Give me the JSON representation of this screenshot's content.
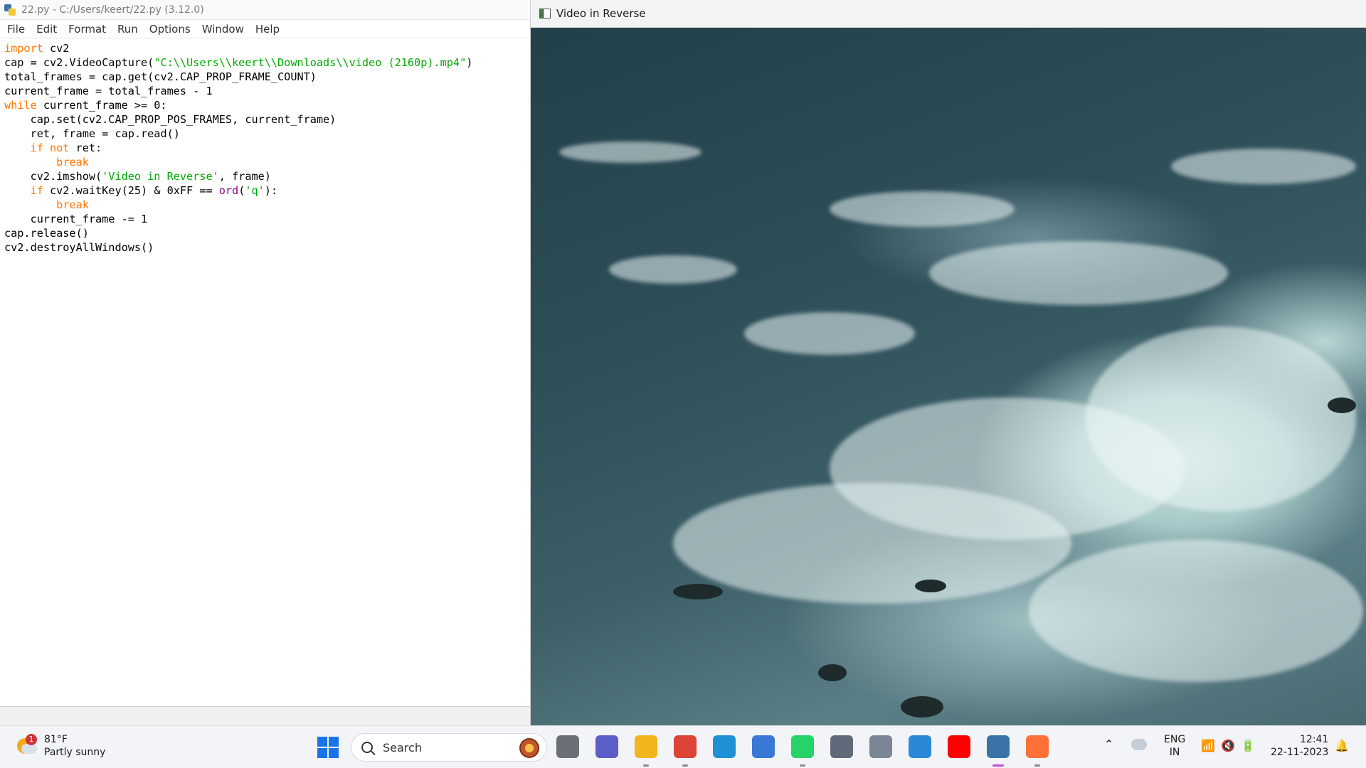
{
  "idle": {
    "title": "22.py - C:/Users/keert/22.py (3.12.0)",
    "menu": [
      "File",
      "Edit",
      "Format",
      "Run",
      "Options",
      "Window",
      "Help"
    ],
    "code_lines": [
      [
        {
          "t": "import",
          "c": "kw"
        },
        {
          "t": " cv2"
        }
      ],
      [
        {
          "t": "cap = cv2.VideoCapture("
        },
        {
          "t": "\"C:\\\\Users\\\\keert\\\\Downloads\\\\video (2160p).mp4\"",
          "c": "str"
        },
        {
          "t": ")"
        }
      ],
      [
        {
          "t": "total_frames = cap.get(cv2.CAP_PROP_FRAME_COUNT)"
        }
      ],
      [
        {
          "t": "current_frame = total_frames - 1"
        }
      ],
      [
        {
          "t": "while",
          "c": "kw"
        },
        {
          "t": " current_frame >= 0:"
        }
      ],
      [
        {
          "t": "    cap.set(cv2.CAP_PROP_POS_FRAMES, current_frame)"
        }
      ],
      [
        {
          "t": "    ret, frame = cap.read()"
        }
      ],
      [
        {
          "t": "    "
        },
        {
          "t": "if not",
          "c": "kw"
        },
        {
          "t": " ret:"
        }
      ],
      [
        {
          "t": "        "
        },
        {
          "t": "break",
          "c": "kw"
        }
      ],
      [
        {
          "t": "    cv2.imshow("
        },
        {
          "t": "'Video in Reverse'",
          "c": "str"
        },
        {
          "t": ", frame)"
        }
      ],
      [
        {
          "t": "    "
        },
        {
          "t": "if",
          "c": "kw"
        },
        {
          "t": " cv2.waitKey(25) & 0xFF == "
        },
        {
          "t": "ord",
          "c": "bi"
        },
        {
          "t": "("
        },
        {
          "t": "'q'",
          "c": "str"
        },
        {
          "t": "):"
        }
      ],
      [
        {
          "t": "        "
        },
        {
          "t": "break",
          "c": "kw"
        }
      ],
      [
        {
          "t": "    current_frame -= 1"
        }
      ],
      [
        {
          "t": "cap.release()"
        }
      ],
      [
        {
          "t": "cv2.destroyAllWindows()"
        }
      ]
    ]
  },
  "video": {
    "title": "Video in Reverse"
  },
  "taskbar": {
    "weather_temp": "81°F",
    "weather_desc": "Partly sunny",
    "weather_badge": "1",
    "search_label": "Search",
    "lang_top": "ENG",
    "lang_bottom": "IN",
    "time": "12:41",
    "date": "22-11-2023",
    "apps": [
      {
        "name": "task-view-icon",
        "color": "#6b6f76"
      },
      {
        "name": "meet-icon",
        "color": "#5b5fc7"
      },
      {
        "name": "file-explorer-icon",
        "color": "#f2b51c"
      },
      {
        "name": "chrome-icon",
        "color": "#db4437"
      },
      {
        "name": "edge-icon",
        "color": "#1f8fd6"
      },
      {
        "name": "store-icon",
        "color": "#3a78d6"
      },
      {
        "name": "whatsapp-icon",
        "color": "#25d366"
      },
      {
        "name": "settings-icon",
        "color": "#5f6b7a"
      },
      {
        "name": "camera-icon",
        "color": "#7a8696"
      },
      {
        "name": "feedback-icon",
        "color": "#2b88d8"
      },
      {
        "name": "youtube-icon",
        "color": "#ff0000"
      },
      {
        "name": "idle-icon",
        "color": "#3b73a8"
      },
      {
        "name": "firefox-icon",
        "color": "#ff7139"
      }
    ]
  }
}
